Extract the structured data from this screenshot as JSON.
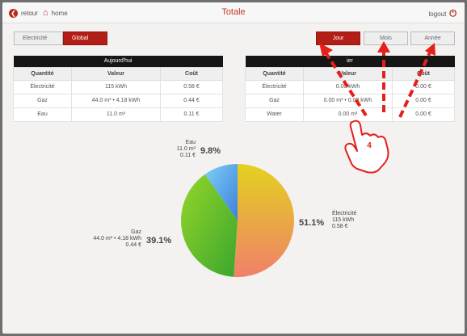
{
  "header": {
    "back_label": "retour",
    "home_label": "home",
    "title": "Totale",
    "logout_label": "logout"
  },
  "tabs": [
    {
      "label": "Electricité",
      "active": false
    },
    {
      "label": "Global",
      "active": true
    }
  ],
  "period_buttons": [
    {
      "label": "Jour",
      "active": true
    },
    {
      "label": "Mois",
      "active": false
    },
    {
      "label": "Année",
      "active": false
    }
  ],
  "table_today": {
    "title": "Aujourd'hui",
    "columns": [
      "Quantité",
      "Valeur",
      "Coût"
    ],
    "rows": [
      [
        "Électricité",
        "115 kWh",
        "0.58 €"
      ],
      [
        "Gaz",
        "44.0 m³ • 4.18 kWh",
        "0.44 €"
      ],
      [
        "Eau",
        "11.0 m³",
        "0.11 €"
      ]
    ]
  },
  "table_yesterday": {
    "title": "ier",
    "columns": [
      "Quantité",
      "Valeur",
      "Coût"
    ],
    "rows": [
      [
        "Électricité",
        "0.00 kWh",
        "0.00 €"
      ],
      [
        "Gaz",
        "0.00 m³ • 0.00 kWh",
        "0.00 €"
      ],
      [
        "Water",
        "0.00 m³",
        "0.00 €"
      ]
    ]
  },
  "pie": {
    "eau": {
      "name": "Eau",
      "value": "11.0 m³",
      "cost": "0.11 €",
      "percent": "9.8%",
      "share": 9.8
    },
    "gaz": {
      "name": "Gaz",
      "value": "44.0 m³ • 4.18 kWh",
      "cost": "0.44 €",
      "percent": "39.1%",
      "share": 39.1
    },
    "elec": {
      "name": "Électricité",
      "value": "115 kWh",
      "cost": "0.58 €",
      "percent": "51.1%",
      "share": 51.1
    }
  },
  "annotation": {
    "step_number": "4",
    "arrow_color": "#e3201b"
  },
  "colors": {
    "accent": "#b31f16",
    "title": "#c0392b"
  }
}
